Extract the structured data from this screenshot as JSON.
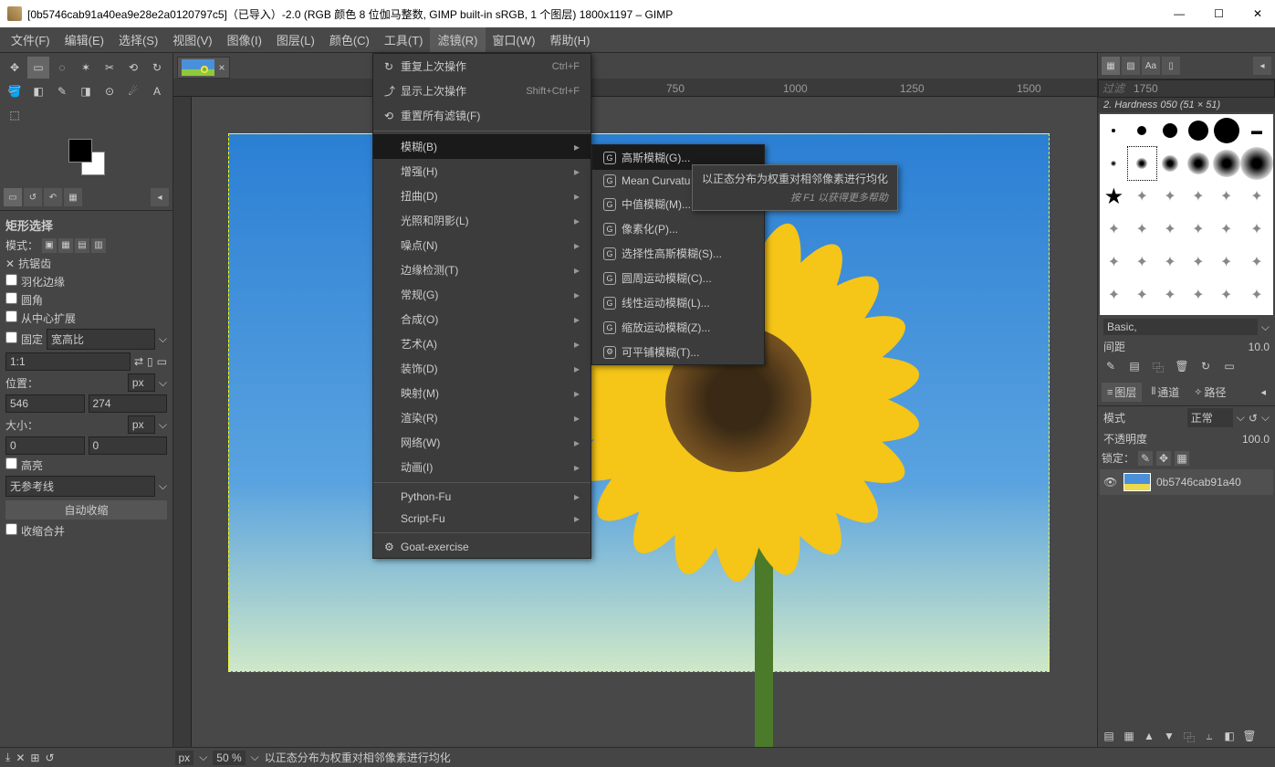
{
  "titlebar": {
    "title": "[0b5746cab91a40ea9e28e2a0120797c5]（已导入）-2.0 (RGB 颜色 8 位伽马整数, GIMP built-in sRGB, 1 个图层) 1800x1197 – GIMP",
    "min": "—",
    "max": "☐",
    "close": "✕"
  },
  "menubar": [
    "文件(F)",
    "编辑(E)",
    "选择(S)",
    "视图(V)",
    "图像(I)",
    "图层(L)",
    "颜色(C)",
    "工具(T)",
    "滤镜(R)",
    "窗口(W)",
    "帮助(H)"
  ],
  "menubar_active_index": 8,
  "tool_options": {
    "header": "矩形选择",
    "mode_label": "模式：",
    "antialias": "抗锯齿",
    "feather": "羽化边缘",
    "rounded": "圆角",
    "from_center": "从中心扩展",
    "fixed": "固定",
    "fixed_mode": "宽高比",
    "ratio": "1:1",
    "position": "位置：",
    "pos_unit": "px",
    "pos_x": "546",
    "pos_y": "274",
    "size": "大小：",
    "size_unit": "px",
    "size_w": "0",
    "size_h": "0",
    "highlight": "高亮",
    "no_guides": "无参考线",
    "auto_shrink": "自动收缩",
    "shrink_merged": "收缩合并"
  },
  "ruler_marks": [
    "750",
    "1000",
    "1250",
    "1500",
    "1750"
  ],
  "filters_menu": {
    "repeat": "重复上次操作",
    "repeat_sc": "Ctrl+F",
    "reshow": "显示上次操作",
    "reshow_sc": "Shift+Ctrl+F",
    "reset": "重置所有滤镜(F)",
    "items": [
      "模糊(B)",
      "增强(H)",
      "扭曲(D)",
      "光照和阴影(L)",
      "噪点(N)",
      "边缘检测(T)",
      "常规(G)",
      "合成(O)",
      "艺术(A)",
      "装饰(D)",
      "映射(M)",
      "渲染(R)",
      "网络(W)",
      "动画(I)"
    ],
    "highlight_index": 0,
    "pythonfu": "Python-Fu",
    "scriptfu": "Script-Fu",
    "goat": "Goat-exercise"
  },
  "blur_submenu": {
    "items": [
      "高斯模糊(G)...",
      "Mean Curvatu",
      "中值模糊(M)...",
      "像素化(P)...",
      "选择性高斯模糊(S)...",
      "圆周运动模糊(C)...",
      "线性运动模糊(L)...",
      "缩放运动模糊(Z)...",
      "可平铺模糊(T)..."
    ],
    "highlight_index": 0
  },
  "tooltip": {
    "line1": "以正态分布为权重对相邻像素进行均化",
    "line2": "按 F1 以获得更多帮助"
  },
  "right": {
    "filter_placeholder": "过滤",
    "brush_label": "2. Hardness 050 (51 × 51)",
    "basic": "Basic,",
    "spacing": "间距",
    "spacing_val": "10.0",
    "layers_tab": "图层",
    "channels_tab": "通道",
    "paths_tab": "路径",
    "mode": "模式",
    "mode_val": "正常",
    "opacity": "不透明度",
    "opacity_val": "100.0",
    "lock": "锁定：",
    "layer_name": "0b5746cab91a40"
  },
  "status": {
    "unit": "px",
    "zoom": "50 %",
    "msg": "以正态分布为权重对相邻像素进行均化"
  }
}
